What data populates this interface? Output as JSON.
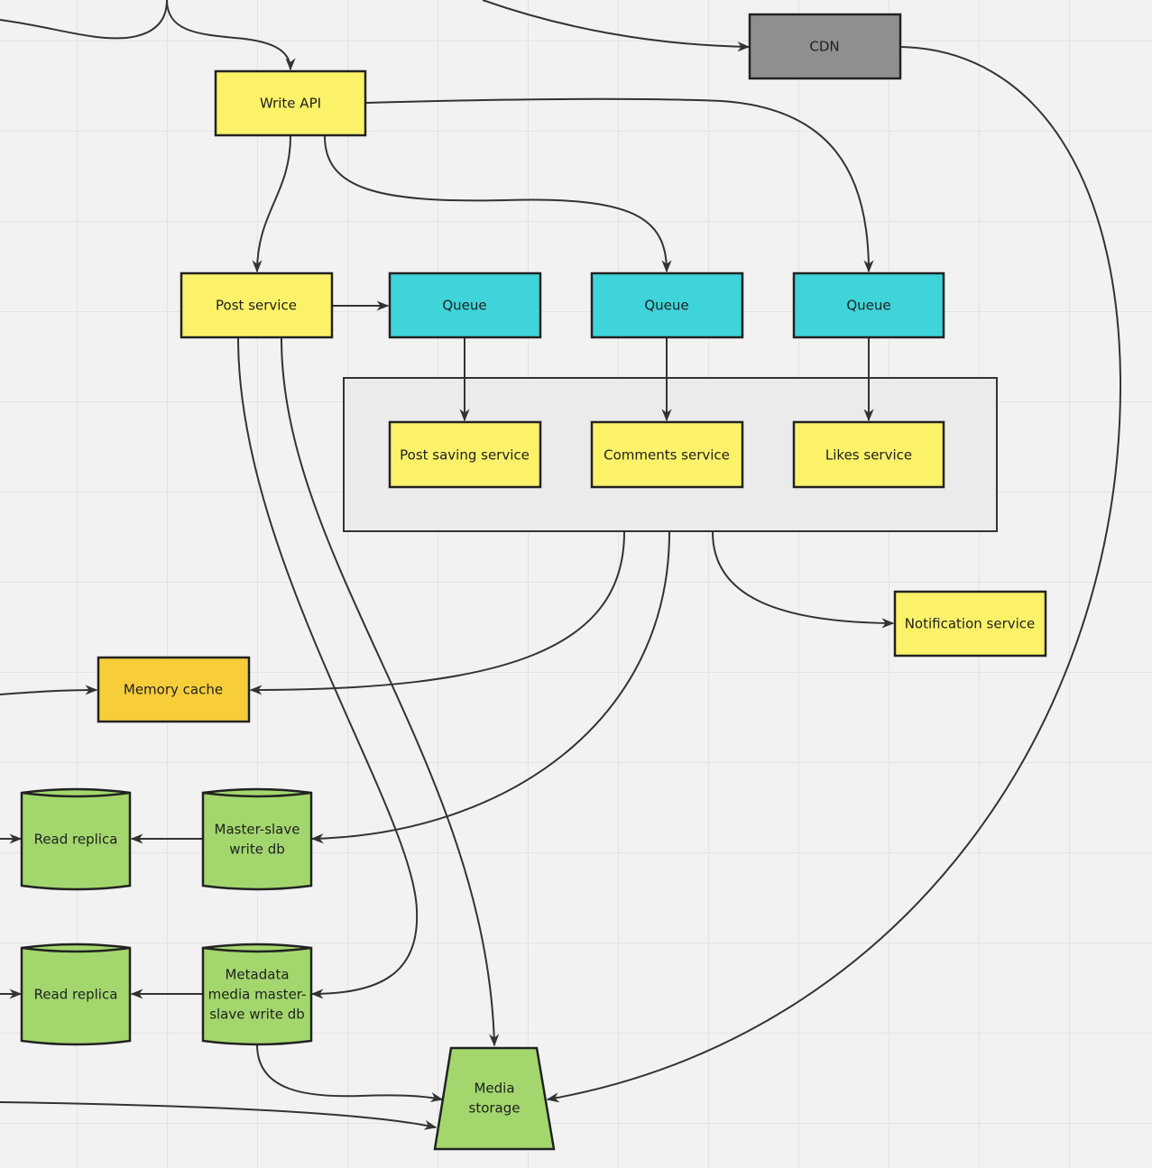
{
  "colors": {
    "service": "#fbf26a",
    "queue": "#3fd4d9",
    "cdn": "#8f8f8f",
    "cache": "#f7cd3a",
    "storage": "#a3d76e",
    "group": "#ebebeb",
    "edge": "#333333"
  },
  "nodes": {
    "write_api": "Write API",
    "cdn": "CDN",
    "post_service": "Post service",
    "queue1": "Queue",
    "queue2": "Queue",
    "queue3": "Queue",
    "post_saving_service": "Post saving service",
    "comments_service": "Comments service",
    "likes_service": "Likes service",
    "notification_service": "Notification service",
    "memory_cache": "Memory cache",
    "read_replica_1": "Read replica",
    "master_slave_db": [
      "Master-slave",
      "write db"
    ],
    "read_replica_2": "Read replica",
    "metadata_db": [
      "Metadata",
      "media master-",
      "slave write db"
    ],
    "media_storage": [
      "Media",
      "storage"
    ]
  }
}
